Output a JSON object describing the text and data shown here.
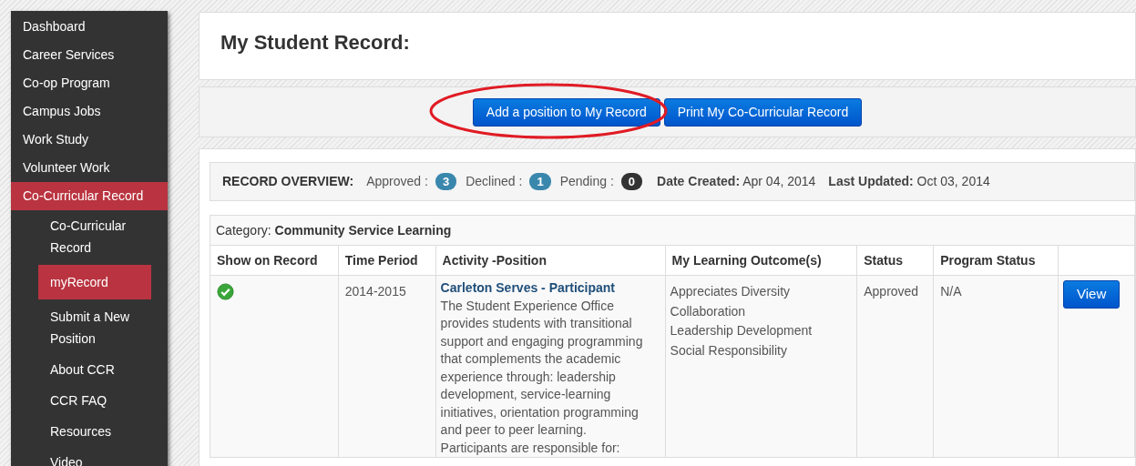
{
  "sidebar": {
    "items": [
      {
        "label": "Dashboard",
        "selected": false
      },
      {
        "label": "Career Services",
        "selected": false
      },
      {
        "label": "Co-op Program",
        "selected": false
      },
      {
        "label": "Campus Jobs",
        "selected": false
      },
      {
        "label": "Work Study",
        "selected": false
      },
      {
        "label": "Volunteer Work",
        "selected": false
      },
      {
        "label": "Co-Curricular Record",
        "selected": true,
        "children": [
          {
            "label": "Co-Curricular Record",
            "selected": false
          },
          {
            "label": "myRecord",
            "selected": true
          },
          {
            "label": "Submit a New Position",
            "selected": false
          },
          {
            "label": "About CCR",
            "selected": false
          },
          {
            "label": "CCR FAQ",
            "selected": false
          },
          {
            "label": "Resources",
            "selected": false
          },
          {
            "label": "Video",
            "selected": false
          }
        ]
      }
    ]
  },
  "page_title": "My Student Record:",
  "buttons": [
    "Add a position to My Record",
    "Print My Co-Curricular Record"
  ],
  "overview": {
    "title": "RECORD OVERVIEW:",
    "counts": [
      {
        "label": "Approved :",
        "count": "3",
        "color": "#3a87ad"
      },
      {
        "label": "Declined :",
        "count": "1",
        "color": "#3a87ad"
      },
      {
        "label": "Pending :",
        "count": "0",
        "color": "#333333"
      }
    ],
    "dates": [
      {
        "label": "Date Created:",
        "value": "Apr 04, 2014"
      },
      {
        "label": "Last Updated:",
        "value": "Oct 03, 2014"
      }
    ]
  },
  "table": {
    "category_label": "Category:",
    "category": "Community Service Learning",
    "columns": [
      "Show on Record",
      "Time Period",
      "Activity -Position",
      "My Learning Outcome(s)",
      "Status",
      "Program Status",
      ""
    ],
    "rows": [
      {
        "shown": true,
        "period": "2014-2015",
        "activity": "Carleton Serves - Participant",
        "description": "The Student Experience Office provides students with transitional support and engaging programming that complements the academic experience through: leadership development, service-learning initiatives, orientation programming and peer to peer learning. Participants are responsible for:",
        "outcomes": [
          "Appreciates Diversity",
          "Collaboration",
          "Leadership Development",
          "Social Responsibility"
        ],
        "status": "Approved",
        "program_status": "N/A",
        "action": "View"
      }
    ]
  }
}
